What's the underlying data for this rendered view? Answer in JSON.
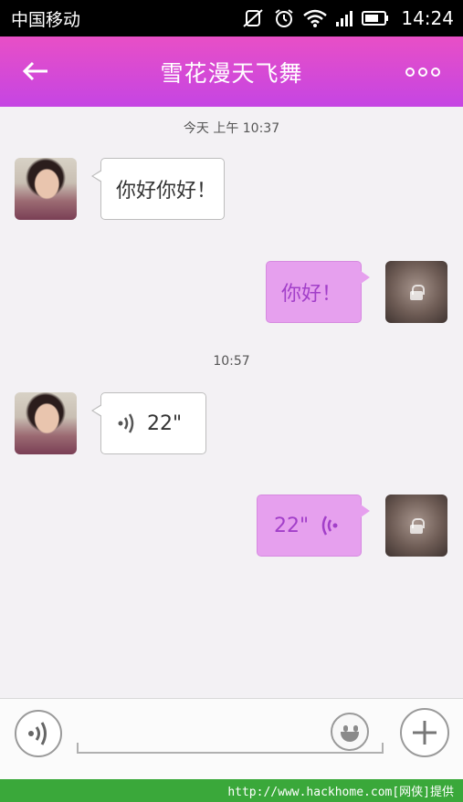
{
  "statusbar": {
    "carrier": "中国移动",
    "time": "14:24",
    "icons": [
      "mute-icon",
      "alarm-icon",
      "wifi-icon",
      "signal-icon",
      "battery-icon"
    ]
  },
  "header": {
    "title": "雪花漫天飞舞",
    "back_icon": "back-arrow-icon",
    "more_icon": "more-icon",
    "color_top": "#e84fc6",
    "color_bottom": "#c545e3"
  },
  "messages": {
    "ts1": "今天 上午 10:37",
    "msg1": "你好你好！",
    "msg2": "你好！",
    "ts2": "10:57",
    "voice1_duration": "22\"",
    "voice2_duration": "22\""
  },
  "inputbar": {
    "placeholder": "",
    "voice_icon": "voice-icon",
    "emoji_icon": "emoji-icon",
    "plus_icon": "plus-icon"
  },
  "colors": {
    "outgoing_bubble": "#e6a0ee",
    "outgoing_text": "#a23fc9",
    "chat_background": "#f3f1f4",
    "watermark_bar": "#3aa83a"
  },
  "watermark": "http://www.hackhome.com[网侠]提供"
}
